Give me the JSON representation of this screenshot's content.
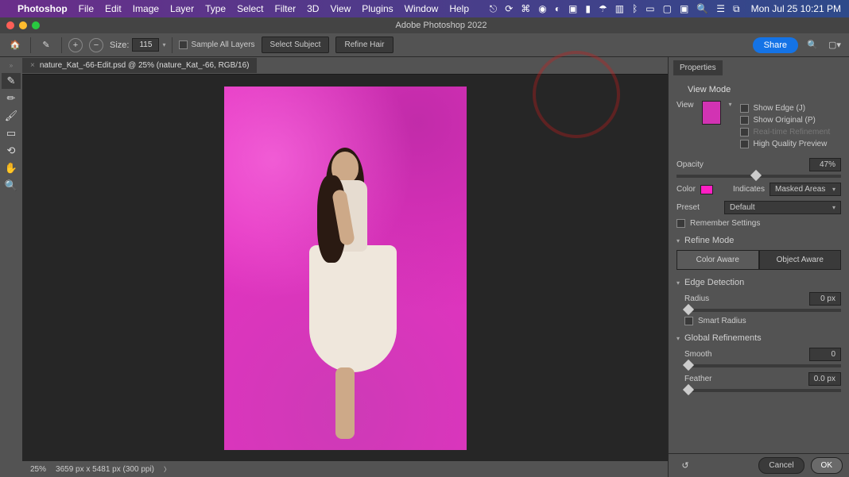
{
  "menubar": {
    "app": "Photoshop",
    "items": [
      "File",
      "Edit",
      "Image",
      "Layer",
      "Type",
      "Select",
      "Filter",
      "3D",
      "View",
      "Plugins",
      "Window",
      "Help"
    ],
    "clock": "Mon Jul 25  10:21 PM"
  },
  "window_title": "Adobe Photoshop 2022",
  "options": {
    "size_label": "Size:",
    "size_value": "115",
    "sample_all_layers": "Sample All Layers",
    "select_subject": "Select Subject",
    "refine_hair": "Refine Hair",
    "share": "Share"
  },
  "doc_tab": "nature_Kat_-66-Edit.psd @ 25% (nature_Kat_-66, RGB/16)",
  "status": {
    "zoom": "25%",
    "dims": "3659 px x 5481 px (300 ppi)"
  },
  "panel": {
    "title": "Properties",
    "view_mode": "View Mode",
    "view_label": "View",
    "show_edge": "Show Edge (J)",
    "show_original": "Show Original (P)",
    "realtime": "Real-time Refinement",
    "hq_preview": "High Quality Preview",
    "opacity_label": "Opacity",
    "opacity_value": "47%",
    "color_label": "Color",
    "indicates_label": "Indicates",
    "indicates_value": "Masked Areas",
    "preset_label": "Preset",
    "preset_value": "Default",
    "remember": "Remember Settings",
    "refine_mode": "Refine Mode",
    "color_aware": "Color Aware",
    "object_aware": "Object Aware",
    "edge_detection": "Edge Detection",
    "radius_label": "Radius",
    "radius_value": "0 px",
    "smart_radius": "Smart Radius",
    "global": "Global Refinements",
    "smooth_label": "Smooth",
    "smooth_value": "0",
    "feather_label": "Feather",
    "feather_value": "0.0 px",
    "cancel": "Cancel",
    "ok": "OK"
  },
  "colors": {
    "mask": "#ff1fc4"
  }
}
